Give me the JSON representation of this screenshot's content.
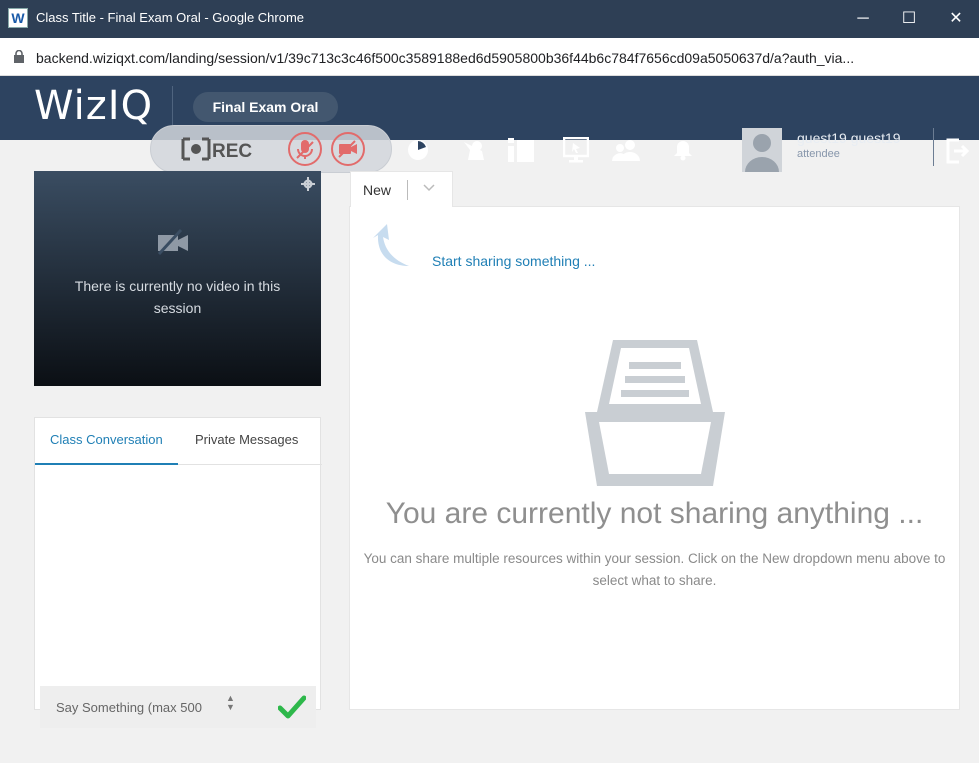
{
  "window": {
    "app_icon_letter": "W",
    "title": "Class Title - Final Exam Oral - Google Chrome",
    "minimize": "─",
    "maximize": "☐",
    "close": "✕"
  },
  "address_bar": {
    "url": "backend.wiziqxt.com/landing/session/v1/39c713c3c46f500c3589188ed6d5905800b36f44b6c784f7656cd09a5050637d/a?auth_via..."
  },
  "header": {
    "logo": "WizIQ",
    "class_name": "Final Exam Oral",
    "rec_label": "REC",
    "user_name": "guest19 guest19",
    "user_role": "attendee"
  },
  "video": {
    "no_video_text": "There is currently no video in this session"
  },
  "chat": {
    "tabs": [
      "Class Conversation",
      "Private Messages"
    ],
    "active_tab": 0,
    "input_placeholder": "Say Something (max 500"
  },
  "content": {
    "tab_label": "New",
    "start_sharing": "Start sharing something ...",
    "empty_title": "You are currently not sharing anything ...",
    "empty_description": "You can share multiple resources within your session. Click on the New dropdown menu above to select what to share."
  },
  "colors": {
    "titlebar": "#2e3f55",
    "header": "#2d4360",
    "accent": "#1f7fb5",
    "send_check": "#2eb84b",
    "mute_red": "#e26b6b"
  }
}
